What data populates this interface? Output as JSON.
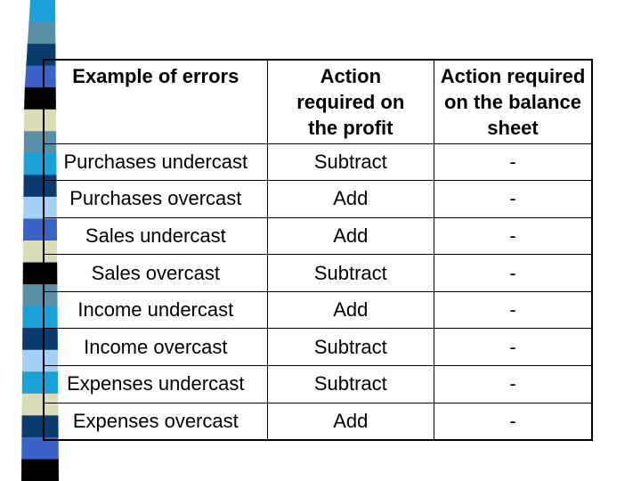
{
  "slide": {
    "decoration": {
      "stripe_colors": [
        "#1ba0d8",
        "#5b8fa8",
        "#0b3a6e",
        "#3c62c8",
        "#000000",
        "#dcdcb8",
        "#5b8fa8",
        "#1ba0d8",
        "#0b3a6e",
        "#a6cff5",
        "#3c62c8",
        "#dcdcb8",
        "#000000",
        "#5b8fa8",
        "#1ba0d8",
        "#0b3a6e",
        "#a6cff5",
        "#1ba0d8",
        "#dcdcb8",
        "#0b3a6e",
        "#3c62c8",
        "#000000"
      ]
    },
    "table": {
      "headers": [
        "Example of errors",
        "Action required on the profit",
        "Action required on the balance sheet"
      ],
      "header_lines": {
        "col1": [
          "Example of errors"
        ],
        "col2": [
          "Action",
          "required on",
          "the profit"
        ],
        "col3": [
          "Action required",
          "on the balance",
          "sheet"
        ]
      },
      "rows": [
        {
          "error": "Purchases undercast",
          "profit": "Subtract",
          "balance": "-"
        },
        {
          "error": "Purchases overcast",
          "profit": "Add",
          "balance": "-"
        },
        {
          "error": "Sales undercast",
          "profit": "Add",
          "balance": "-"
        },
        {
          "error": "Sales overcast",
          "profit": "Subtract",
          "balance": "-"
        },
        {
          "error": "Income undercast",
          "profit": "Add",
          "balance": "-"
        },
        {
          "error": "Income overcast",
          "profit": "Subtract",
          "balance": "-"
        },
        {
          "error": "Expenses undercast",
          "profit": "Subtract",
          "balance": "-"
        },
        {
          "error": "Expenses overcast",
          "profit": "Add",
          "balance": "-"
        }
      ]
    }
  }
}
